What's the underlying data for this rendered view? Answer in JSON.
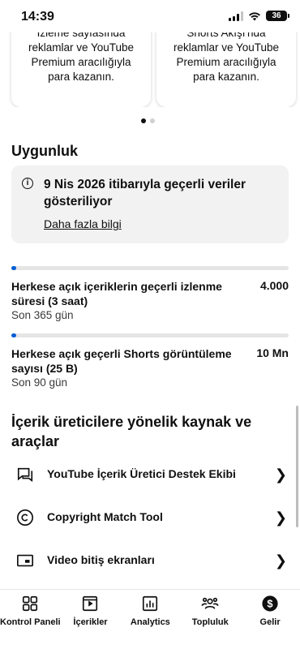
{
  "status_bar": {
    "time": "14:39",
    "battery": "36"
  },
  "carousel": {
    "left_card_text": "İzleme sayfasında\nreklamlar ve YouTube\nPremium aracılığıyla\npara kazanın.",
    "right_card_text": "Shorts Akışı'nda\nreklamlar ve YouTube\nPremium aracılığıyla\npara kazanın.",
    "active_page": 1,
    "page_count": 2
  },
  "eligibility": {
    "title": "Uygunluk",
    "info_text": "9 Nis 2026 itibarıyla geçerli veriler gösteriliyor",
    "info_link": "Daha fazla bilgi"
  },
  "metrics": [
    {
      "label": "Herkese açık içeriklerin geçerli izlenme süresi (3 saat)",
      "value": "4.000",
      "period": "Son 365 gün",
      "progress": 0.0008
    },
    {
      "label": "Herkese açık geçerli Shorts görüntüleme sayısı (25 B)",
      "value": "10 Mn",
      "period": "Son 90 gün",
      "progress": 0.0025
    }
  ],
  "resources": {
    "title": "İçerik üreticilere yönelik kaynak ve araçlar",
    "items": [
      {
        "label": "YouTube İçerik Üretici Destek Ekibi",
        "icon": "feedback-chat-icon"
      },
      {
        "label": "Copyright Match Tool",
        "icon": "copyright-icon"
      },
      {
        "label": "Video bitiş ekranları",
        "icon": "end-screen-icon"
      }
    ]
  },
  "bottom_nav": [
    {
      "label": "Kontrol Paneli",
      "icon": "dashboard-icon"
    },
    {
      "label": "İçerikler",
      "icon": "content-icon"
    },
    {
      "label": "Analytics",
      "icon": "analytics-icon"
    },
    {
      "label": "Topluluk",
      "icon": "community-icon"
    },
    {
      "label": "Gelir",
      "icon": "earn-icon",
      "active": true
    }
  ],
  "colors": {
    "progress_fill": "#065fd4",
    "info_bg": "#f2f2f2",
    "text": "#0f0f0f"
  }
}
